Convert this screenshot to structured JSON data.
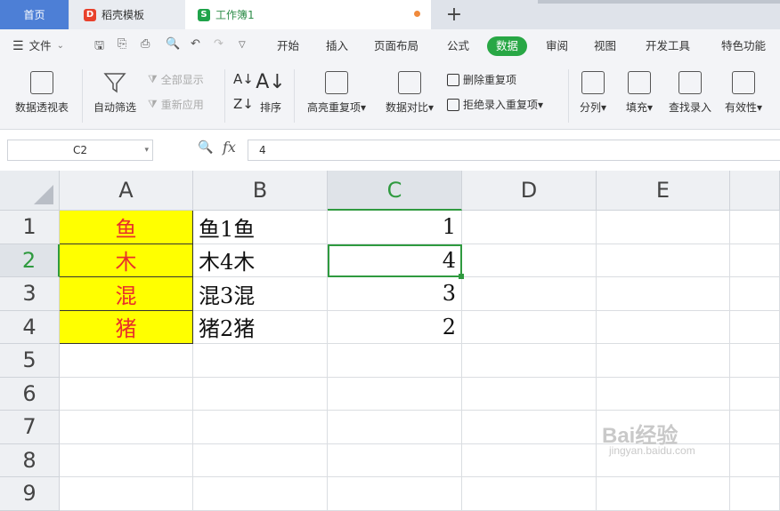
{
  "tabs": {
    "home": "首页",
    "daoke": "稻壳模板",
    "workbook": "工作簿1",
    "new_tab": "+"
  },
  "menu": {
    "file": "文件",
    "items": [
      "开始",
      "插入",
      "页面布局",
      "公式",
      "数据",
      "审阅",
      "视图",
      "开发工具",
      "特色功能"
    ],
    "active": "数据"
  },
  "ribbon": {
    "pivot": "数据透视表",
    "autofilter": "自动筛选",
    "show_all": "全部显示",
    "reapply": "重新应用",
    "sort": "排序",
    "highlight_dup": "高亮重复项",
    "data_compare": "数据对比",
    "remove_dup": "删除重复项",
    "reject_dup": "拒绝录入重复项",
    "split": "分列",
    "fill": "填充",
    "lookup": "查找录入",
    "validity": "有效性"
  },
  "formula_bar": {
    "cell_ref": "C2",
    "fx": "fx",
    "value": "4"
  },
  "sheet": {
    "columns": [
      "A",
      "B",
      "C",
      "D",
      "E"
    ],
    "selected_column": "C",
    "rows": [
      "1",
      "2",
      "3",
      "4",
      "5",
      "6",
      "7",
      "8",
      "9"
    ],
    "selected_row": "2",
    "data": [
      {
        "A": "鱼",
        "B": "鱼1鱼",
        "C": "1"
      },
      {
        "A": "木",
        "B": "木4木",
        "C": "4"
      },
      {
        "A": "混",
        "B": "混3混",
        "C": "3"
      },
      {
        "A": "猪",
        "B": "猪2猪",
        "C": "2"
      }
    ],
    "highlight_color": "#ffff00",
    "highlight_text_color": "#e8302a",
    "accent_color": "#2f9a3f"
  },
  "watermark": {
    "main": "Bai经验",
    "sub": "jingyan.baidu.com"
  }
}
